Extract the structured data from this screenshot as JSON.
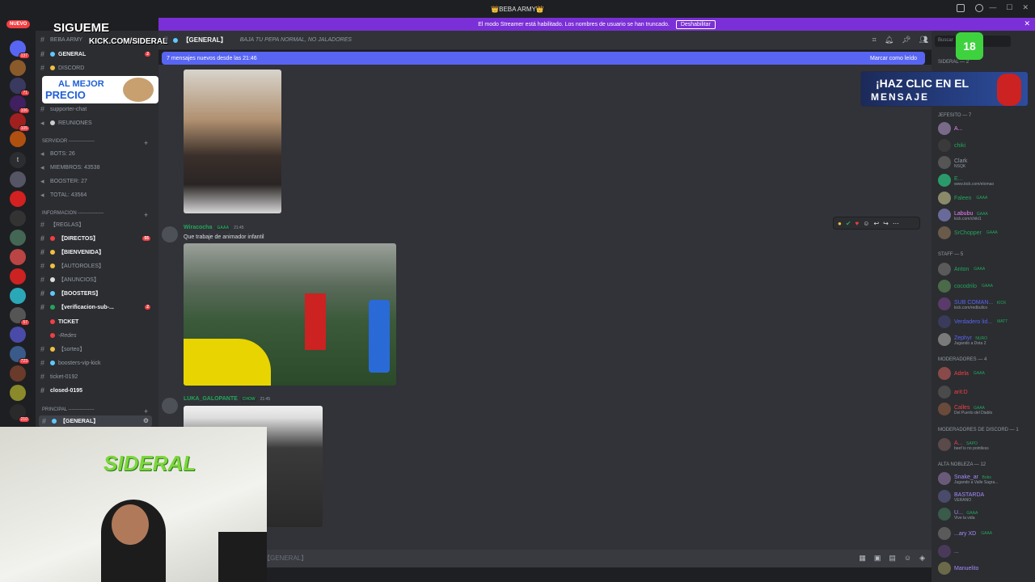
{
  "window": {
    "title": "👑BEBA ARMY👑"
  },
  "banner": {
    "text": "El modo Streamer está habilitado. Los nombres de usuario se han truncado.",
    "button": "Deshabilitar"
  },
  "servers": {
    "nuevo_label": "NUEVO",
    "badges": [
      "137",
      "71",
      "106",
      "105",
      "57",
      "723",
      "210"
    ]
  },
  "overlay": {
    "sigueme": "SIGUEME",
    "kick_url": "KICK.COM/SIDERAL",
    "promo_line1": "AL MEJOR",
    "promo_line2": "PRECIO",
    "cta_line1": "¡HAZ CLIC EN EL",
    "cta_line2": "MENSAJE",
    "age_badge": "18",
    "cam_logo": "SIDERAL"
  },
  "sidebar": {
    "server_name": "BEBA ARMY",
    "channels_top": [
      {
        "label": "GENERAL",
        "bold": true,
        "count": "2"
      },
      {
        "label": "DISCORD"
      },
      {
        "label": "supporter-chat"
      },
      {
        "label": "REUNIONES"
      }
    ],
    "category_servidor": "SERVIDOR ----------------",
    "stats": [
      "BOTS: 26",
      "MIEMBROS: 43538",
      "BOOSTER: 27",
      "TOTAL: 43564"
    ],
    "category_informacion": "INFORMACION ----------------",
    "info_channels": [
      {
        "label": "【REGLAS】"
      },
      {
        "label": "【DIRECTOS】",
        "bold": true,
        "count": "55"
      },
      {
        "label": "【BIENVENIDA】",
        "bold": true
      },
      {
        "label": "【AUTOROLES】"
      },
      {
        "label": "【ANUNCIOS】"
      },
      {
        "label": "【BOOSTERS】",
        "bold": true
      },
      {
        "label": "【verificacion-sub-...",
        "bold": true,
        "count": "2"
      },
      {
        "label": "TICKET"
      },
      {
        "label": "-Redes"
      },
      {
        "label": "【sorteo】"
      },
      {
        "label": "boosters-vip-kick"
      },
      {
        "label": "ticket-0192"
      },
      {
        "label": "closed-0195",
        "bold": true
      }
    ],
    "category_principal": "PRINCIPAL ----------------",
    "selected_channel": "【GENERAL】"
  },
  "channel": {
    "name": "【GENERAL】",
    "topic": "BAJA TU PEPA NORMAL, NO JALADORES",
    "new_messages": "7 mensajes nuevos desde las 21:46",
    "mark_read": "Marcar como leído"
  },
  "messages": [
    {
      "author": "Wiracocha",
      "role": "GAAA",
      "time": "21:45",
      "text": "Que trabaje de animador infantil"
    },
    {
      "author": "LUKA_GALOPANTE",
      "role": "CHOW",
      "time": "21:45",
      "text": ""
    }
  ],
  "composer": {
    "placeholder": "【GENERAL】"
  },
  "members": {
    "search_placeholder": "Buscar",
    "groups": [
      {
        "title": "SIDERAL — 2",
        "members": []
      },
      {
        "title": "JEFESITO — 7",
        "members": [
          {
            "name": "A...",
            "color": "#f47fff",
            "tag": "",
            "sub": ""
          },
          {
            "name": "chiki",
            "color": "#23a55a",
            "tag": "",
            "sub": ""
          },
          {
            "name": "Clark",
            "color": "#949ba4",
            "tag": "",
            "sub": "NSQK"
          },
          {
            "name": "E...",
            "color": "#23a55a",
            "tag": "",
            "sub": "www.kick.com/elomao"
          },
          {
            "name": "Faleen",
            "color": "#23a55a",
            "tag": "GAAA",
            "sub": ""
          },
          {
            "name": "Labubu",
            "color": "#f47fff",
            "tag": "GAAA",
            "sub": "kick.com/chiki1"
          },
          {
            "name": "SrChopper",
            "color": "#23a55a",
            "tag": "GAAA",
            "sub": ""
          }
        ]
      },
      {
        "title": "STAFF — 5",
        "members": [
          {
            "name": "Anton",
            "color": "#23a55a",
            "tag": "GAAA",
            "sub": ""
          },
          {
            "name": "cocodrilo",
            "color": "#23a55a",
            "tag": "GAAA",
            "sub": ""
          },
          {
            "name": "SUB COMAN...",
            "color": "#5865f2",
            "tag": "KICK",
            "sub": "kick.com/redbullco"
          },
          {
            "name": "Verdadero lid...",
            "color": "#5865f2",
            "tag": "MATT",
            "sub": ""
          },
          {
            "name": "Zephyr",
            "color": "#5865f2",
            "tag": "NURO",
            "sub": "Jugando a Dota 2"
          }
        ]
      },
      {
        "title": "MODERADORES — 4",
        "members": [
          {
            "name": "Adela",
            "color": "#f23f43",
            "tag": "GAAA",
            "sub": ""
          },
          {
            "name": "arit:D",
            "color": "#f23f43",
            "tag": "",
            "sub": ""
          },
          {
            "name": "Calles",
            "color": "#f23f43",
            "tag": "GAAA",
            "sub": "Del Puerto del Diablo"
          }
        ]
      },
      {
        "title": "MODERADORES DE DISCORD — 1",
        "members": [
          {
            "name": "A...",
            "color": "#f23f43",
            "tag": "SAPO",
            "sub": "beef is no pointless"
          }
        ]
      },
      {
        "title": "ALTA NOBLEZA — 12",
        "members": [
          {
            "name": "Snake_ar",
            "color": "#a78bfa",
            "tag": "Bobs",
            "sub": "Jugando a Valle Sagra..."
          },
          {
            "name": "BASTARDA",
            "color": "#a78bfa",
            "tag": "",
            "sub": "VERANO"
          },
          {
            "name": "U...",
            "color": "#a78bfa",
            "tag": "GAAA",
            "sub": "Vive la vida"
          },
          {
            "name": "...ary XD",
            "color": "#a78bfa",
            "tag": "GAAA",
            "sub": ""
          },
          {
            "name": "...",
            "color": "#a78bfa",
            "tag": "",
            "sub": ""
          },
          {
            "name": "Manuelito",
            "color": "#a78bfa",
            "tag": "",
            "sub": ""
          }
        ]
      }
    ]
  }
}
